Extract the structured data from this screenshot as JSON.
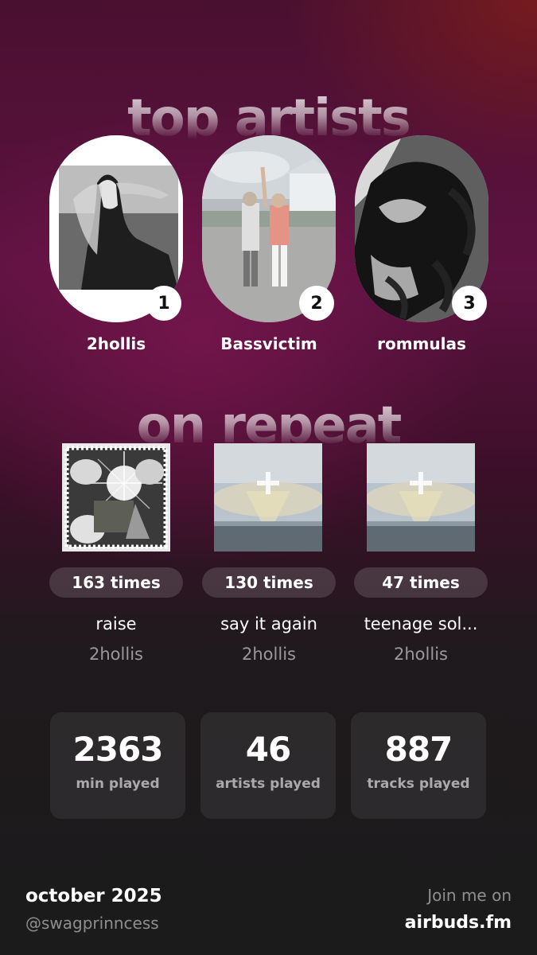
{
  "sections": {
    "top_artists_heading": "top artists",
    "on_repeat_heading": "on repeat"
  },
  "top_artists": [
    {
      "rank": "1",
      "name": "2hollis"
    },
    {
      "rank": "2",
      "name": "Bassvictim"
    },
    {
      "rank": "3",
      "name": "rommulas"
    }
  ],
  "on_repeat": [
    {
      "count": "163 times",
      "title": "raise",
      "artist": "2hollis"
    },
    {
      "count": "130 times",
      "title": "say it again",
      "artist": "2hollis"
    },
    {
      "count": "47 times",
      "title": "teenage sol...",
      "artist": "2hollis"
    }
  ],
  "stats": [
    {
      "value": "2363",
      "label": "min played"
    },
    {
      "value": "46",
      "label": "artists played"
    },
    {
      "value": "887",
      "label": "tracks played"
    }
  ],
  "footer": {
    "month": "october 2025",
    "handle": "@swagprinncess",
    "join": "Join me on",
    "site": "airbuds.fm"
  }
}
